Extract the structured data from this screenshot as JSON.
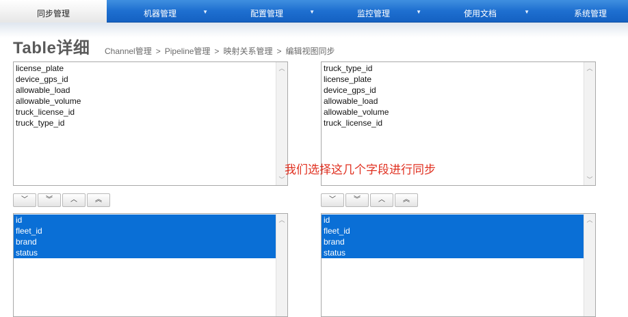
{
  "nav": {
    "items": [
      {
        "label": "同步管理",
        "active": true,
        "caret": false
      },
      {
        "label": "机器管理",
        "active": false,
        "caret": true
      },
      {
        "label": "配置管理",
        "active": false,
        "caret": true
      },
      {
        "label": "监控管理",
        "active": false,
        "caret": true
      },
      {
        "label": "使用文档",
        "active": false,
        "caret": true
      },
      {
        "label": "系统管理",
        "active": false,
        "caret": false
      }
    ],
    "caret_glyph": "▼"
  },
  "header": {
    "title": "Table详细",
    "breadcrumb": [
      "Channel管理",
      "Pipeline管理",
      "映射关系管理",
      "编辑视图同步"
    ],
    "separator": ">"
  },
  "left": {
    "available": [
      "license_plate",
      "device_gps_id",
      "allowable_load",
      "allowable_volume",
      "truck_license_id",
      "truck_type_id"
    ],
    "selected": [
      "id",
      "fleet_id",
      "brand",
      "status"
    ]
  },
  "right": {
    "available": [
      "truck_type_id",
      "license_plate",
      "device_gps_id",
      "allowable_load",
      "allowable_volume",
      "truck_license_id"
    ],
    "selected": [
      "id",
      "fleet_id",
      "brand",
      "status"
    ]
  },
  "order_buttons": [
    "﹀",
    "︾",
    "︿",
    "︽"
  ],
  "annotation": "我们选择这几个字段进行同步",
  "colors": {
    "nav": "#1e6fd0",
    "selected": "#0a6fd6",
    "annotation": "#e03020"
  }
}
